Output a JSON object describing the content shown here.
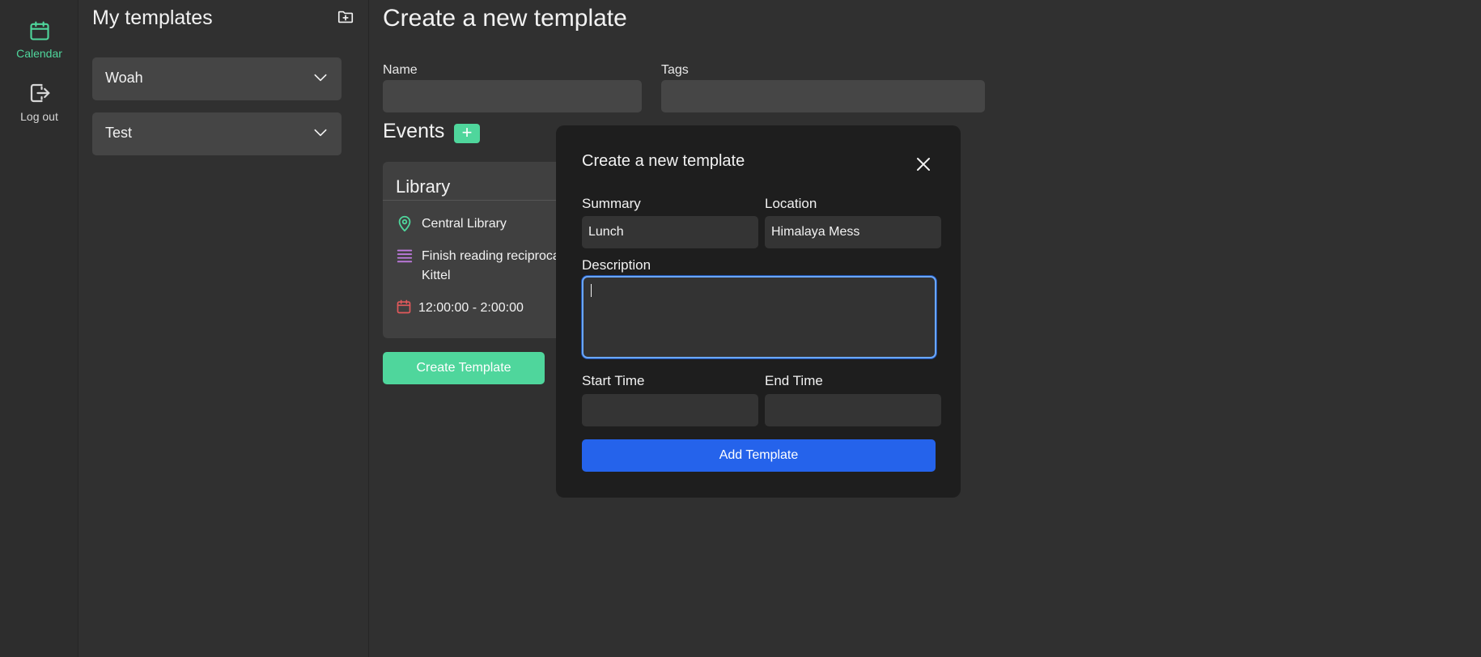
{
  "rail": {
    "calendar_label": "Calendar",
    "logout_label": "Log out",
    "calendar_color": "#4fd69c"
  },
  "templates_panel": {
    "title": "My templates",
    "items": [
      {
        "label": "Woah"
      },
      {
        "label": "Test"
      }
    ]
  },
  "form": {
    "title": "Create a new template",
    "name_label": "Name",
    "name_value": "",
    "tags_label": "Tags",
    "tags_value": "",
    "events_title": "Events",
    "add_event_symbol": "+",
    "create_button": "Create Template"
  },
  "event_card": {
    "title": "Library",
    "location": "Central Library",
    "description_line1": "Finish reading reciproca",
    "description_line2": "Kittel",
    "time": "12:00:00 - 2:00:00"
  },
  "modal": {
    "title": "Create a new template",
    "summary_label": "Summary",
    "summary_value": "Lunch",
    "location_label": "Location",
    "location_value": "Himalaya Mess",
    "description_label": "Description",
    "description_value": "",
    "start_label": "Start Time",
    "start_value": "",
    "end_label": "End Time",
    "end_value": "",
    "submit_label": "Add Template"
  },
  "colors": {
    "accent_green": "#4fd69c",
    "primary_blue": "#2563eb",
    "focus_ring": "#6aa7ff",
    "description_icon": "#c07be0",
    "time_icon": "#e2595b"
  }
}
